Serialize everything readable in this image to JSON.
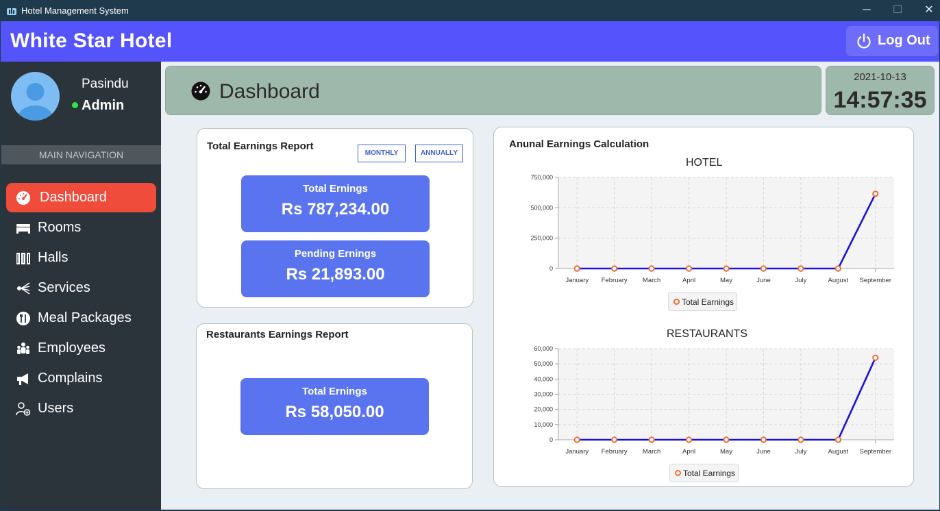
{
  "window": {
    "title": "Hotel Management System",
    "controls": {
      "minimize": "─",
      "maximize": "☐",
      "close": "✕"
    }
  },
  "header": {
    "brand": "White Star Hotel",
    "logout_label": "Log Out",
    "brand_color": "#5553fb"
  },
  "user": {
    "name": "Pasindu",
    "role": "Admin",
    "status_color": "#35e24a"
  },
  "sidebar": {
    "section_header": "MAIN NAVIGATION",
    "items": [
      {
        "label": "Dashboard",
        "icon": "dashboard-gauge-icon",
        "active": true
      },
      {
        "label": "Rooms",
        "icon": "bed-icon",
        "active": false
      },
      {
        "label": "Halls",
        "icon": "hall-icon",
        "active": false
      },
      {
        "label": "Services",
        "icon": "services-icon",
        "active": false
      },
      {
        "label": "Meal Packages",
        "icon": "meal-icon",
        "active": false
      },
      {
        "label": "Employees",
        "icon": "employees-icon",
        "active": false
      },
      {
        "label": "Complains",
        "icon": "megaphone-icon",
        "active": false
      },
      {
        "label": "Users",
        "icon": "users-icon",
        "active": false
      }
    ],
    "active_color": "#ef4c3b"
  },
  "dashboard": {
    "title": "Dashboard",
    "date": "2021-10-13",
    "time": "14:57:35"
  },
  "total_earnings": {
    "title": "Total Earnings Report",
    "monthly_label": "MONTHLY",
    "annually_label": "ANNUALLY",
    "total_label": "Total Ernings",
    "total_value": "Rs 787,234.00",
    "pending_label": "Pending Ernings",
    "pending_value": "Rs 21,893.00"
  },
  "restaurant_earnings": {
    "title": "Restaurants Earnings Report",
    "total_label": "Total Ernings",
    "total_value": "Rs 58,050.00"
  },
  "annual_card": {
    "title": "Anunal Earnings Calculation"
  },
  "chart_data": [
    {
      "type": "line",
      "title": "HOTEL",
      "categories": [
        "January",
        "February",
        "March",
        "April",
        "May",
        "June",
        "July",
        "August",
        "September"
      ],
      "series": [
        {
          "name": "Total Earnings",
          "values": [
            0,
            0,
            0,
            0,
            0,
            0,
            0,
            0,
            615000
          ]
        }
      ],
      "yticks": [
        "0",
        "250,000",
        "500,000",
        "750,000"
      ],
      "ylim": [
        0,
        750000
      ],
      "grid": true,
      "legend": "bottom-center",
      "line_color": "#1a12d8",
      "marker_color": "#f06c33"
    },
    {
      "type": "line",
      "title": "RESTAURANTS",
      "categories": [
        "January",
        "February",
        "March",
        "April",
        "May",
        "June",
        "July",
        "August",
        "September"
      ],
      "series": [
        {
          "name": "Total Earnings",
          "values": [
            0,
            0,
            0,
            0,
            0,
            0,
            0,
            0,
            54000
          ]
        }
      ],
      "yticks": [
        "0",
        "10,000",
        "20,000",
        "30,000",
        "40,000",
        "50,000",
        "60,000"
      ],
      "ylim": [
        0,
        60000
      ],
      "grid": true,
      "legend": "bottom-center",
      "line_color": "#1a12d8",
      "marker_color": "#f06c33"
    }
  ]
}
